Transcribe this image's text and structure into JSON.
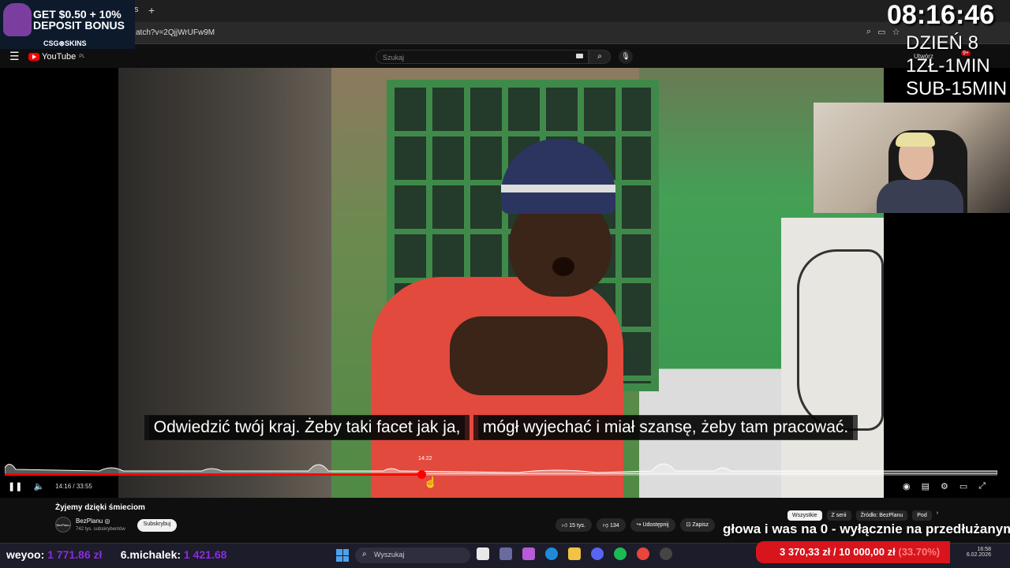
{
  "browser": {
    "tab_partial": "s",
    "url": "atch?v=2QjjWrUFw9M"
  },
  "youtube": {
    "logo_text": "YouTube",
    "logo_region": "PL",
    "search_placeholder": "Szukaj",
    "create_label": "Utwórz",
    "notifications_count": "9+"
  },
  "video": {
    "subtitle_line1": "Odwiedzić twój kraj. Żeby taki facet jak ja,",
    "subtitle_line2": "mógł wyjechać i miał szansę, żeby tam pracować.",
    "hover_time": "14:22",
    "time_display": "14:16 / 33:55",
    "progress_fraction": 0.42,
    "title": "Żyjemy dzięki śmieciom"
  },
  "channel": {
    "avatar_text": "BezPlanu",
    "name": "BezPlanu",
    "verified": "◎",
    "subscribers": "742 tys. subskrybentów",
    "subscribe_label": "Subskrybuj"
  },
  "actions": {
    "likes": "15 tys.",
    "dislikes": "134",
    "share": "Udostępnij",
    "save": "Zapisz"
  },
  "chips": [
    "Wszystkie",
    "Z serii",
    "Źródło: BezPlanu",
    "Pod"
  ],
  "overlay": {
    "ad_line1": "GET $0.50 + 10%",
    "ad_line2": "DEPOSIT BONUS",
    "ad_brand": "CSG⊛SKINS",
    "clock": "08:16:46",
    "info_lines": [
      "DZIEŃ 8",
      "1ZŁ-1MIN",
      "SUB-15MIN"
    ],
    "ticker": "głowa i was na 0 - wyłącznie na przedłużanym",
    "donate_current": "3 370,33 zł",
    "donate_goal": "10 000,00 zł",
    "donate_pct": "(33.70%)",
    "top_donor_1": "weyoo:",
    "top_donor_1_amount": "1 771.86 zł",
    "top_donor_2": "6.michalek:",
    "top_donor_2_amount": "1 421.68"
  },
  "taskbar": {
    "search_placeholder": "Wyszukaj",
    "time": "16:58",
    "date": "6.02.2026"
  },
  "colors": {
    "yt_red": "#ff0000",
    "donate_bar": "#d8141c",
    "donor_amount": "#8a2be2"
  }
}
